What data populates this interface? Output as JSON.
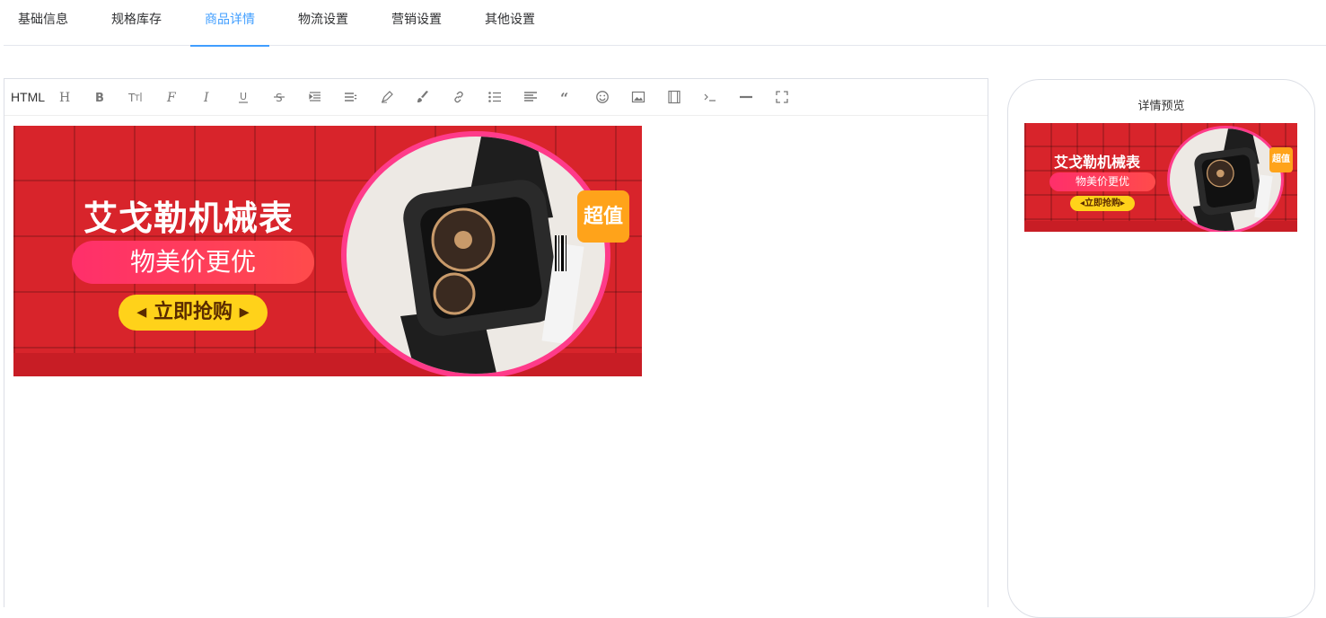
{
  "tabs": [
    {
      "label": "基础信息",
      "active": false
    },
    {
      "label": "规格库存",
      "active": false
    },
    {
      "label": "商品详情",
      "active": true
    },
    {
      "label": "物流设置",
      "active": false
    },
    {
      "label": "营销设置",
      "active": false
    },
    {
      "label": "其他设置",
      "active": false
    }
  ],
  "toolbar": {
    "html_label": "HTML",
    "tools": [
      "heading-icon",
      "bold-icon",
      "font-size-icon",
      "font-name-icon",
      "italic-icon",
      "underline-icon",
      "strikethrough-icon",
      "indent-icon",
      "line-height-icon",
      "fore-color-icon",
      "back-color-icon",
      "link-icon",
      "list-icon",
      "justify-icon",
      "quote-icon",
      "emoticon-icon",
      "image-icon",
      "video-icon",
      "code-icon",
      "divider-icon",
      "fullscreen-icon"
    ]
  },
  "banner": {
    "title": "艾戈勒机械表",
    "subtitle": "物美价更优",
    "button": "立即抢购",
    "tag": "超值"
  },
  "preview": {
    "title": "详情预览"
  },
  "colors": {
    "accent": "#409eff",
    "banner_red": "#d8242b",
    "tag_orange": "#ffa31a",
    "button_yellow": "#ffd21a"
  }
}
